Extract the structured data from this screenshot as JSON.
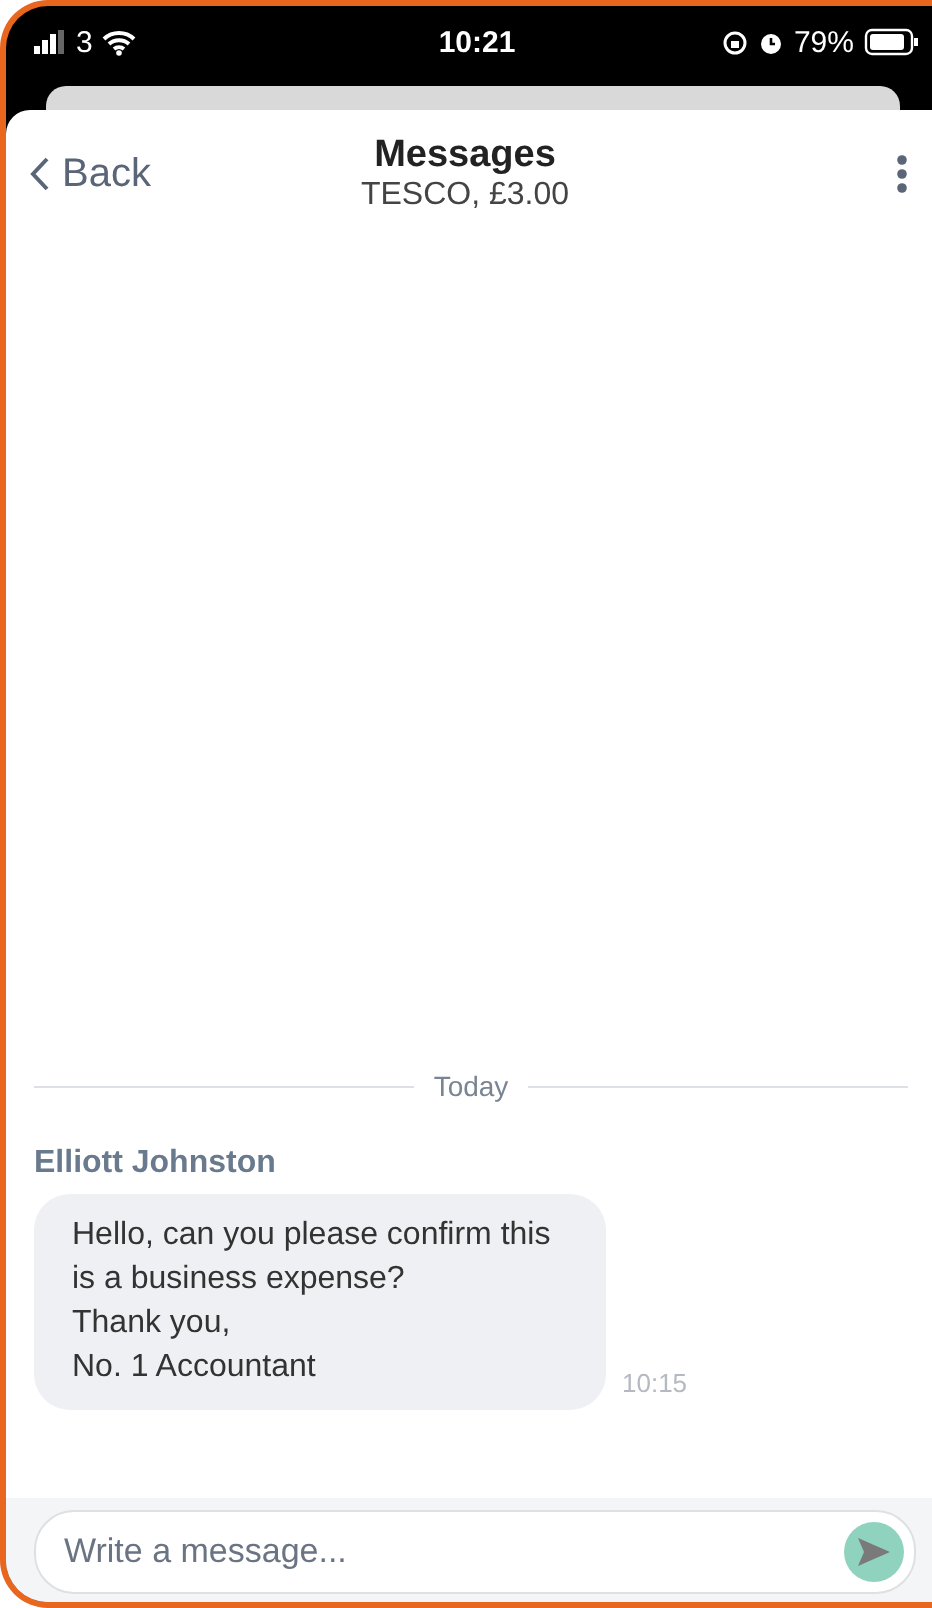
{
  "status_bar": {
    "carrier": "3",
    "time": "10:21",
    "battery": "79%"
  },
  "header": {
    "back": "Back",
    "title": "Messages",
    "subtitle": "TESCO, £3.00"
  },
  "divider": {
    "label": "Today"
  },
  "messages": [
    {
      "sender": "Elliott Johnston",
      "text": "Hello, can you please confirm this\nis a business expense?\nThank you,\nNo. 1 Accountant",
      "time": "10:15"
    }
  ],
  "composer": {
    "placeholder": "Write a message..."
  }
}
